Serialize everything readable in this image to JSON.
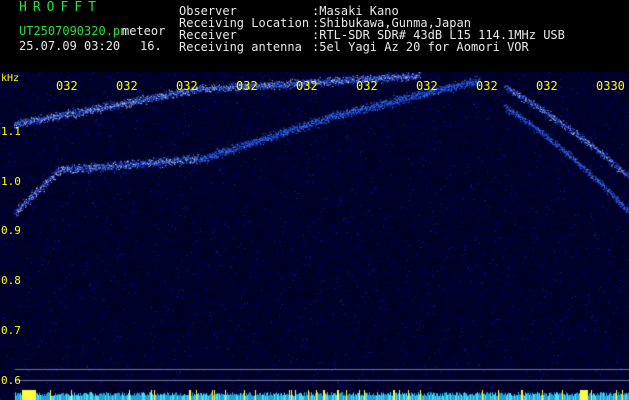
{
  "header": {
    "app_title": "HROFFT",
    "filename": "UT2507090320.pn",
    "mode": "meteor",
    "datetime": "25.07.09 03:20",
    "second": "16.",
    "info": [
      {
        "label": "Observer",
        "value": ":Masaki Kano"
      },
      {
        "label": "Receiving Location",
        "value": ":Shibukawa,Gunma,Japan"
      },
      {
        "label": "Receiver",
        "value": ":RTL-SDR SDR# 43dB L15 114.1MHz USB"
      },
      {
        "label": "Receiving antenna",
        "value": ":5el Yagi Az 20 for Aomori VOR"
      }
    ]
  },
  "spectrogram": {
    "y_unit": "kHz",
    "y_ticks": [
      "1.1",
      "1.0",
      "0.9",
      "0.8",
      "0.7",
      "0.6"
    ],
    "x_ticks": [
      "032",
      "032",
      "032",
      "032",
      "032",
      "032",
      "032",
      "032",
      "032",
      "0330"
    ]
  },
  "colors": {
    "header_green": "#22e03a",
    "label_yellow": "#ffff00",
    "text_white": "#e8e8e8",
    "background": "#000000",
    "trace_blue": "#2a6cff",
    "noise_floor": "#07073a"
  }
}
